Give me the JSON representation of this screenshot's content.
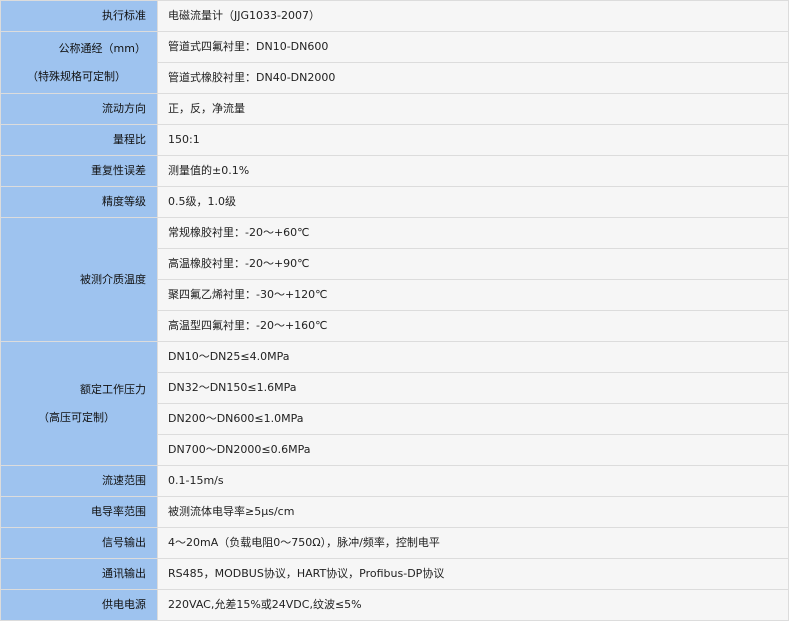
{
  "rows": [
    {
      "label": "执行标准",
      "values": [
        "电磁流量计（JJG1033-2007）"
      ]
    },
    {
      "label_lines": [
        "公称通经（mm）",
        "（特殊规格可定制）"
      ],
      "values": [
        "管道式四氟衬里：DN10-DN600",
        "管道式橡胶衬里：DN40-DN2000"
      ]
    },
    {
      "label": "流动方向",
      "values": [
        "正，反，净流量"
      ]
    },
    {
      "label": "量程比",
      "values": [
        "150:1"
      ]
    },
    {
      "label": "重复性误差",
      "values": [
        "测量值的±0.1%"
      ]
    },
    {
      "label": "精度等级",
      "values": [
        "0.5级，1.0级"
      ]
    },
    {
      "label": "被测介质温度",
      "values": [
        "常规橡胶衬里：-20～+60℃",
        "高温橡胶衬里：-20～+90℃",
        "聚四氟乙烯衬里：-30～+120℃",
        "高温型四氟衬里：-20～+160℃"
      ]
    },
    {
      "label_lines": [
        "额定工作压力",
        "（高压可定制）"
      ],
      "values": [
        "DN10～DN25≤4.0MPa",
        "DN32～DN150≤1.6MPa",
        "DN200～DN600≤1.0MPa",
        "DN700～DN2000≤0.6MPa"
      ]
    },
    {
      "label": "流速范围",
      "values": [
        "0.1-15m/s"
      ]
    },
    {
      "label": "电导率范围",
      "values": [
        "被测流体电导率≥5μs/cm"
      ]
    },
    {
      "label": "信号输出",
      "values": [
        "4～20mA（负载电阻0～750Ω），脉冲/频率，控制电平"
      ]
    },
    {
      "label": "通讯输出",
      "values": [
        "RS485，MODBUS协议，HART协议，Profibus-DP协议"
      ]
    },
    {
      "label": "供电电源",
      "values": [
        "220VAC,允差15%或24VDC,纹波≤5%"
      ]
    }
  ]
}
